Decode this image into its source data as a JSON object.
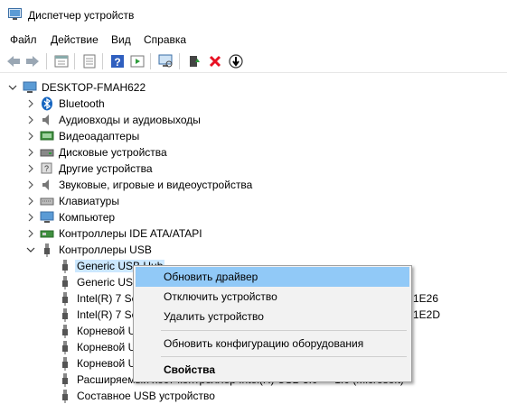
{
  "window": {
    "title": "Диспетчер устройств"
  },
  "menu": [
    "Файл",
    "Действие",
    "Вид",
    "Справка"
  ],
  "toolbar": {
    "icons": [
      "back-arrow-icon",
      "forward-arrow-icon",
      "properties-view-icon",
      "device-list-icon",
      "help-icon",
      "play-icon",
      "monitor-scan-icon",
      "update-driver-icon",
      "delete-x-icon",
      "download-driver-icon"
    ],
    "colors": {
      "delete": "#e81123",
      "help": "#2f5fbf",
      "green": "#2e9c3b"
    }
  },
  "tree": {
    "root": "DESKTOP-FMAH622",
    "categories": [
      {
        "label": "Bluetooth",
        "icon": "bluetooth-icon"
      },
      {
        "label": "Аудиовходы и аудиовыходы",
        "icon": "speaker-icon"
      },
      {
        "label": "Видеоадаптеры",
        "icon": "display-adapter-icon"
      },
      {
        "label": "Дисковые устройства",
        "icon": "disk-drive-icon"
      },
      {
        "label": "Другие устройства",
        "icon": "unknown-device-icon"
      },
      {
        "label": "Звуковые, игровые и видеоустройства",
        "icon": "speaker-icon"
      },
      {
        "label": "Клавиатуры",
        "icon": "keyboard-icon"
      },
      {
        "label": "Компьютер",
        "icon": "computer-icon"
      },
      {
        "label": "Контроллеры IDE ATA/ATAPI",
        "icon": "ide-controller-icon"
      },
      {
        "label": "Контроллеры USB",
        "icon": "usb-controller-icon"
      }
    ],
    "usb_children": [
      {
        "label": "Generic USB Hub",
        "selected": true
      },
      {
        "label": "Generic USB"
      },
      {
        "label": "Intel(R) 7 Se"
      },
      {
        "label": "Intel(R) 7 Se"
      },
      {
        "label": "Корневой U"
      },
      {
        "label": "Корневой U"
      },
      {
        "label": "Корневой U"
      },
      {
        "label": "Расширяемый хост-контроллер Intel(R) USB 3.0 — 1.0 (Microsoft)"
      },
      {
        "label": "Составное USB устройство"
      }
    ],
    "partial_right_texts": [
      "1E26",
      "1E2D"
    ]
  },
  "context_menu": {
    "items": [
      {
        "label": "Обновить драйвер",
        "highlighted": true
      },
      {
        "label": "Отключить устройство"
      },
      {
        "label": "Удалить устройство"
      },
      {
        "label": "Обновить конфигурацию оборудования"
      },
      {
        "label": "Свойства",
        "bold": true
      }
    ]
  }
}
